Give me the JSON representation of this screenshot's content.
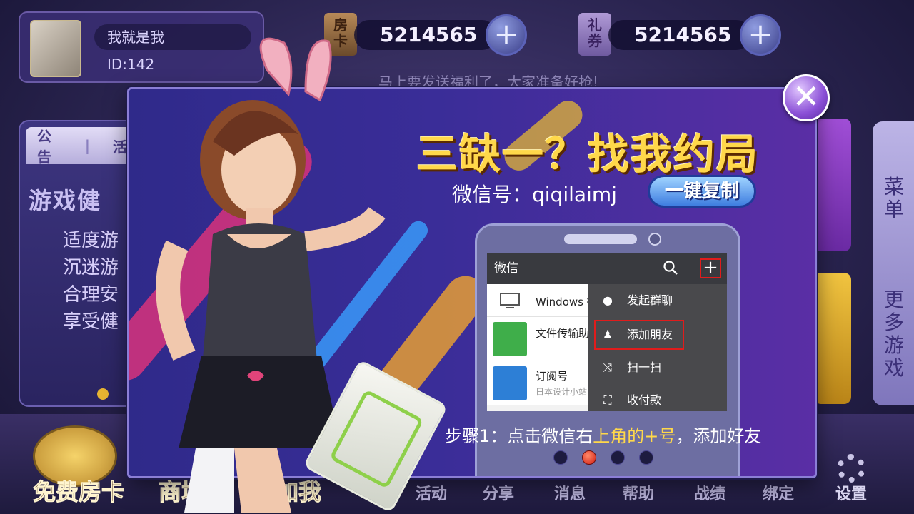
{
  "profile": {
    "nickname": "我就是我",
    "id_text": "ID:142"
  },
  "resources": {
    "room_card": {
      "icon_text": "房\n卡",
      "value": "5214565"
    },
    "coupon": {
      "icon_text": "礼\n券",
      "value": "5214565"
    }
  },
  "marquee_text": "马上要发送福利了，大家准备好抢!",
  "notice_board": {
    "tabs": [
      "公告",
      "活"
    ],
    "title": "游戏健",
    "lines": [
      "适度游",
      "沉迷游",
      "合理安",
      "享受健"
    ]
  },
  "side": {
    "menu_label": "菜\n单",
    "more_games_label": "更\n多\n游\n戏"
  },
  "bottom_buttons": {
    "free_card": "免费房卡",
    "shop": "商城",
    "add_me": "加我"
  },
  "bottom_nav": [
    "活动",
    "分享",
    "消息",
    "帮助",
    "战绩",
    "绑定",
    "设置"
  ],
  "dialog": {
    "headline": "三缺一？找我约局",
    "wechat_label": "微信号：qiqilaimj",
    "copy_button": "一键复制",
    "phone": {
      "app_title": "微信",
      "plus_symbol": "+",
      "chats": [
        {
          "title": "Windows 微",
          "subtitle": ""
        },
        {
          "title": "文件传输助",
          "subtitle": ""
        },
        {
          "title": "订阅号",
          "subtitle": "日本设计小站"
        }
      ],
      "menu": [
        {
          "icon": "chat-bubble-icon",
          "label": "发起群聊"
        },
        {
          "icon": "add-friend-icon",
          "label": "添加朋友"
        },
        {
          "icon": "scan-icon",
          "label": "扫一扫"
        },
        {
          "icon": "payment-icon",
          "label": "收付款"
        }
      ]
    },
    "step_prefix": "步骤1：点击微信右",
    "step_highlight": "上角的+号",
    "step_suffix": "，添加好友",
    "page_count": 4,
    "active_page": 2,
    "close_symbol": "✕"
  },
  "colors": {
    "accent": "#ffd84a",
    "highlight_red": "#e01c1c",
    "dialog_bg": "#3a2d98"
  }
}
